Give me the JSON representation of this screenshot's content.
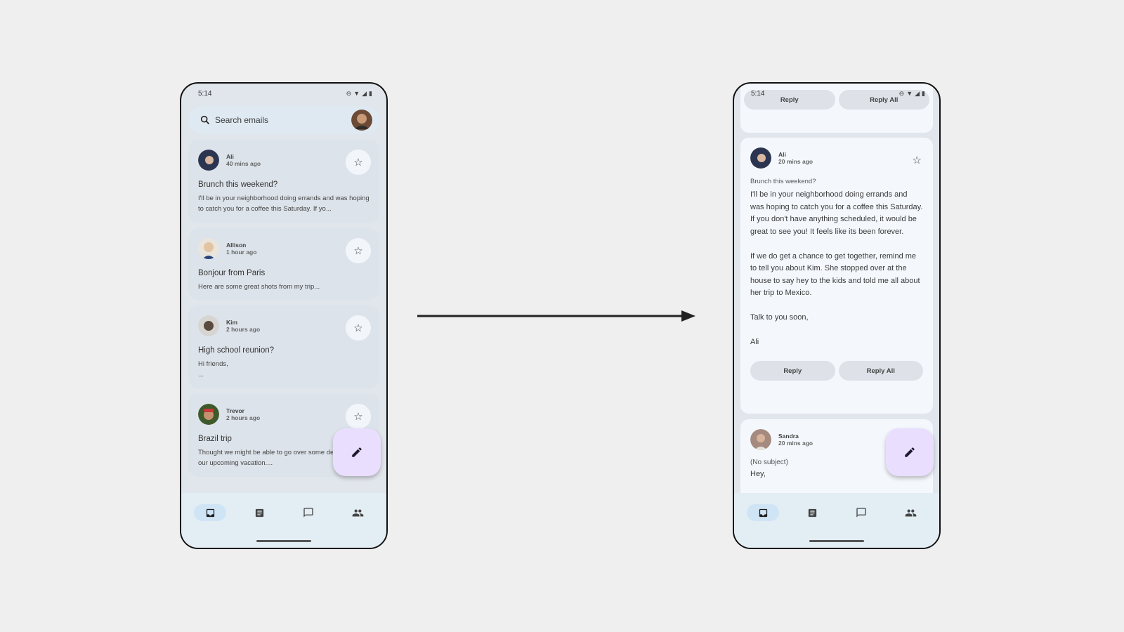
{
  "status_bar": {
    "time": "5:14",
    "icons": [
      "do-not-disturb-icon",
      "wifi-icon",
      "signal-icon",
      "battery-icon"
    ]
  },
  "left_phone": {
    "search": {
      "placeholder": "Search emails"
    },
    "emails": [
      {
        "sender": "Ali",
        "time": "40 mins ago",
        "subject": "Brunch this weekend?",
        "preview": "I'll be in your neighborhood doing errands and was hoping to catch you for a coffee this Saturday. If yo...",
        "avatar_color": "#2b3550"
      },
      {
        "sender": "Allison",
        "time": "1 hour ago",
        "subject": "Bonjour from Paris",
        "preview": "Here are some great shots from my trip...",
        "avatar_color": "#d9b48a"
      },
      {
        "sender": "Kim",
        "time": "2 hours ago",
        "subject": "High school reunion?",
        "preview": "Hi friends,",
        "preview2": "...",
        "avatar_color": "#5a4a40"
      },
      {
        "sender": "Trevor",
        "time": "2 hours ago",
        "subject": "Brazil trip",
        "preview": "Thought we might be able to go over some details about our upcoming vacation....",
        "avatar_color": "#7a4a2a"
      }
    ]
  },
  "right_phone": {
    "top_actions": {
      "reply": "Reply",
      "reply_all": "Reply All"
    },
    "open_email": {
      "sender": "Ali",
      "time": "20 mins ago",
      "subject": "Brunch this weekend?",
      "body": [
        "I'll be in your neighborhood doing errands and was hoping to catch you for a coffee this Saturday. If you don't have anything scheduled, it would be great to see you! It feels like its been forever.",
        "If we do get a chance to get together, remind me to tell you about Kim. She stopped over at the house to say hey to the kids and told me all about her trip to Mexico.",
        "Talk to you soon,",
        "Ali"
      ],
      "reply": "Reply",
      "reply_all": "Reply All"
    },
    "next_email": {
      "sender": "Sandra",
      "time": "20 mins ago",
      "subject": "(No subject)",
      "preview": "Hey,"
    }
  },
  "bottom_nav": [
    {
      "icon": "inbox-icon",
      "active": true
    },
    {
      "icon": "articles-icon",
      "active": false
    },
    {
      "icon": "chat-icon",
      "active": false
    },
    {
      "icon": "contacts-icon",
      "active": false
    }
  ],
  "colors": {
    "fab": "#eadeff",
    "nav_active": "#cfe5f6",
    "background": "#efefef"
  }
}
